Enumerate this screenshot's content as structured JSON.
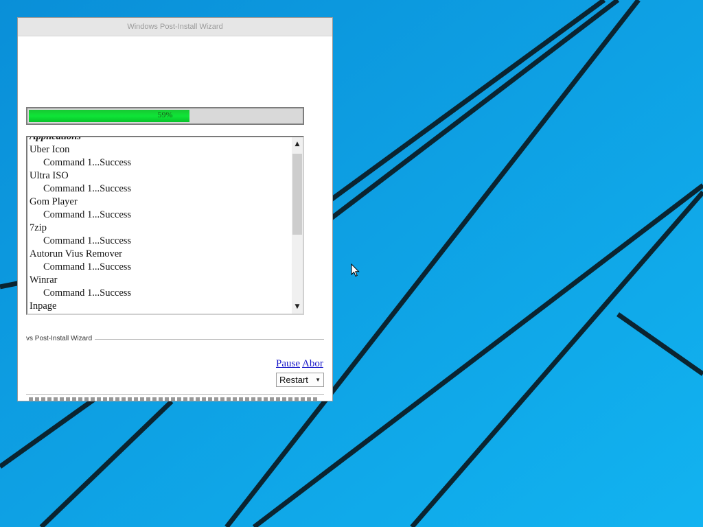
{
  "window": {
    "title": "Windows Post-Install Wizard"
  },
  "progress": {
    "value": 59,
    "label": "59%",
    "fill_color": "#0fe537"
  },
  "log": {
    "heading": "Applications",
    "entries": [
      {
        "app": "Uber Icon",
        "status": "Command 1...Success"
      },
      {
        "app": "Ultra ISO",
        "status": "Command 1...Success"
      },
      {
        "app": "Gom Player",
        "status": "Command 1...Success"
      },
      {
        "app": "7zip",
        "status": "Command 1...Success"
      },
      {
        "app": "Autorun Vius Remover",
        "status": "Command 1...Success"
      },
      {
        "app": "Winrar",
        "status": "Command 1...Success"
      }
    ],
    "last_app": "Inpage"
  },
  "section_legend": "vs Post-Install Wizard",
  "controls": {
    "pause_label": "Pause",
    "abort_label": "Abor",
    "restart_value": "Restart"
  },
  "desktop": {
    "background_color": "#0f9ce4",
    "line_color": "#0a2a3a"
  }
}
